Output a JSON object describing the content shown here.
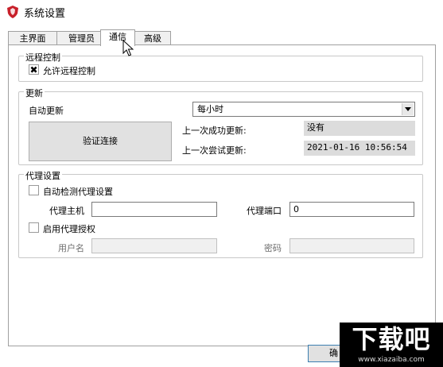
{
  "window": {
    "title": "系统设置"
  },
  "tabs": [
    {
      "label": "主界面"
    },
    {
      "label": "管理员"
    },
    {
      "label": "通信"
    },
    {
      "label": "高级"
    }
  ],
  "remote_control": {
    "group_title": "远程控制",
    "allow_label": "允许远程控制",
    "allow_checked": true
  },
  "update": {
    "group_title": "更新",
    "auto_update_label": "自动更新",
    "frequency_selected": "每小时",
    "verify_button": "验证连接",
    "last_success_label": "上一次成功更新:",
    "last_success_value": "没有",
    "last_attempt_label": "上一次尝试更新:",
    "last_attempt_value": "2021-01-16 10:56:54"
  },
  "proxy": {
    "group_title": "代理设置",
    "auto_detect_label": "自动检测代理设置",
    "auto_detect_checked": false,
    "host_label": "代理主机",
    "host_value": "",
    "port_label": "代理端口",
    "port_value": "0",
    "auth_label": "启用代理授权",
    "auth_checked": false,
    "username_label": "用户名",
    "username_value": "",
    "password_label": "密码",
    "password_value": ""
  },
  "footer": {
    "ok_button": "确"
  },
  "watermark": {
    "main": "下载吧",
    "url": "www.xiazaiba.com"
  }
}
